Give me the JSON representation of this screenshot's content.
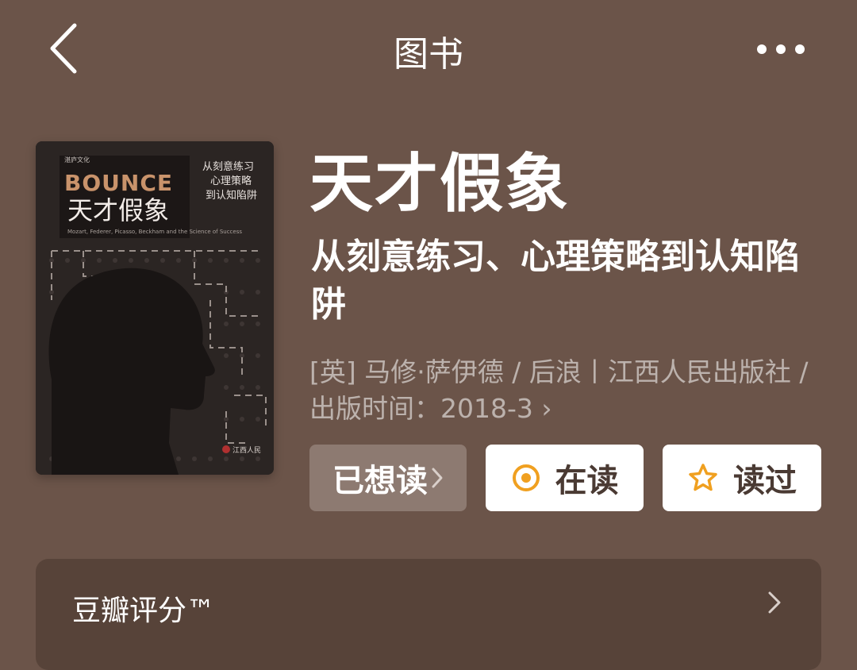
{
  "header": {
    "title": "图书"
  },
  "cover": {
    "publisher_small": "湛庐文化",
    "bounce": "BOUNCE",
    "cn_title": "天才假象",
    "side_text": "从刻意练习 心理策略 到认知陷阱",
    "en_subtitle": "Mozart, Federer, Picasso, Beckham and the Science of Success",
    "publisher_mark": "江西人民"
  },
  "book": {
    "title": "天才假象",
    "subtitle": "从刻意练习、心理策略到认知陷阱",
    "meta": "[英] 马修·萨伊德 / 后浪丨江西人民出版社 / 出版时间：2018-3",
    "meta_arrow": "›"
  },
  "actions": {
    "want_label": "已想读",
    "reading_label": "在读",
    "read_label": "读过"
  },
  "rating": {
    "label": "豆瓣评分™"
  },
  "colors": {
    "background": "#6b5449",
    "accent_orange": "#f0a020",
    "card_bg": "#574339"
  }
}
